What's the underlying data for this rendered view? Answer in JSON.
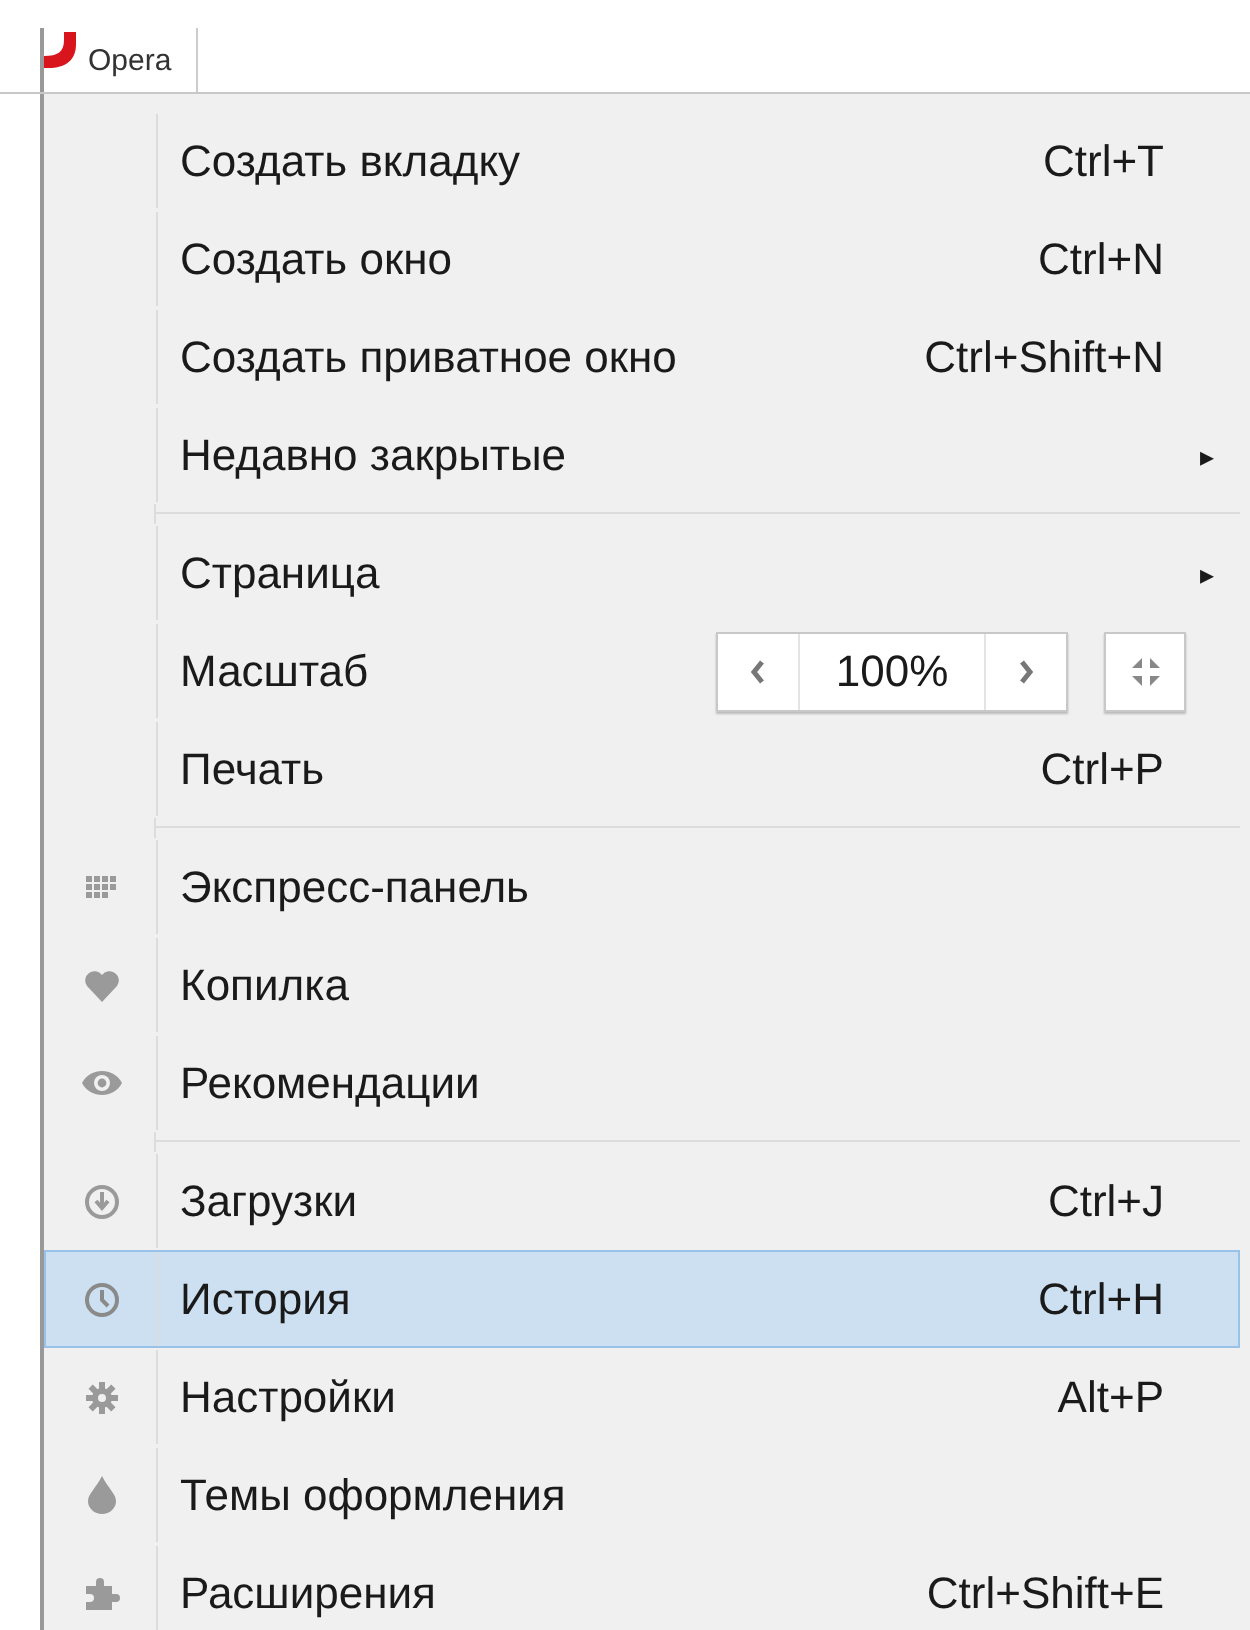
{
  "tab": {
    "title": "Opera"
  },
  "menu": {
    "groups": [
      {
        "items": [
          {
            "kind": "item",
            "label": "Создать вкладку",
            "shortcut": "Ctrl+T",
            "selected": false
          },
          {
            "kind": "item",
            "label": "Создать окно",
            "shortcut": "Ctrl+N",
            "selected": false
          },
          {
            "kind": "item",
            "label": "Создать приватное окно",
            "shortcut": "Ctrl+Shift+N",
            "selected": false
          },
          {
            "kind": "submenu",
            "label": "Недавно закрытые",
            "arrow": "▸",
            "selected": false
          }
        ]
      },
      {
        "items": [
          {
            "kind": "submenu",
            "label": "Страница",
            "arrow": "▸",
            "selected": false
          },
          {
            "kind": "zoom",
            "label": "Масштаб",
            "value": "100%",
            "selected": false
          },
          {
            "kind": "item",
            "label": "Печать",
            "shortcut": "Ctrl+P",
            "selected": false
          }
        ]
      },
      {
        "items": [
          {
            "kind": "item",
            "label": "Экспресс-панель",
            "selected": false
          },
          {
            "kind": "item",
            "label": "Копилка",
            "selected": false
          },
          {
            "kind": "item",
            "label": "Рекомендации",
            "selected": false
          }
        ]
      },
      {
        "items": [
          {
            "kind": "item",
            "label": "Загрузки",
            "shortcut": "Ctrl+J",
            "selected": false
          },
          {
            "kind": "item",
            "label": "История",
            "shortcut": "Ctrl+H",
            "selected": true
          },
          {
            "kind": "item",
            "label": "Настройки",
            "shortcut": "Alt+P",
            "selected": false
          },
          {
            "kind": "item",
            "label": "Темы оформления",
            "selected": false
          },
          {
            "kind": "item",
            "label": "Расширения",
            "shortcut": "Ctrl+Shift+E",
            "selected": false
          }
        ]
      }
    ]
  }
}
